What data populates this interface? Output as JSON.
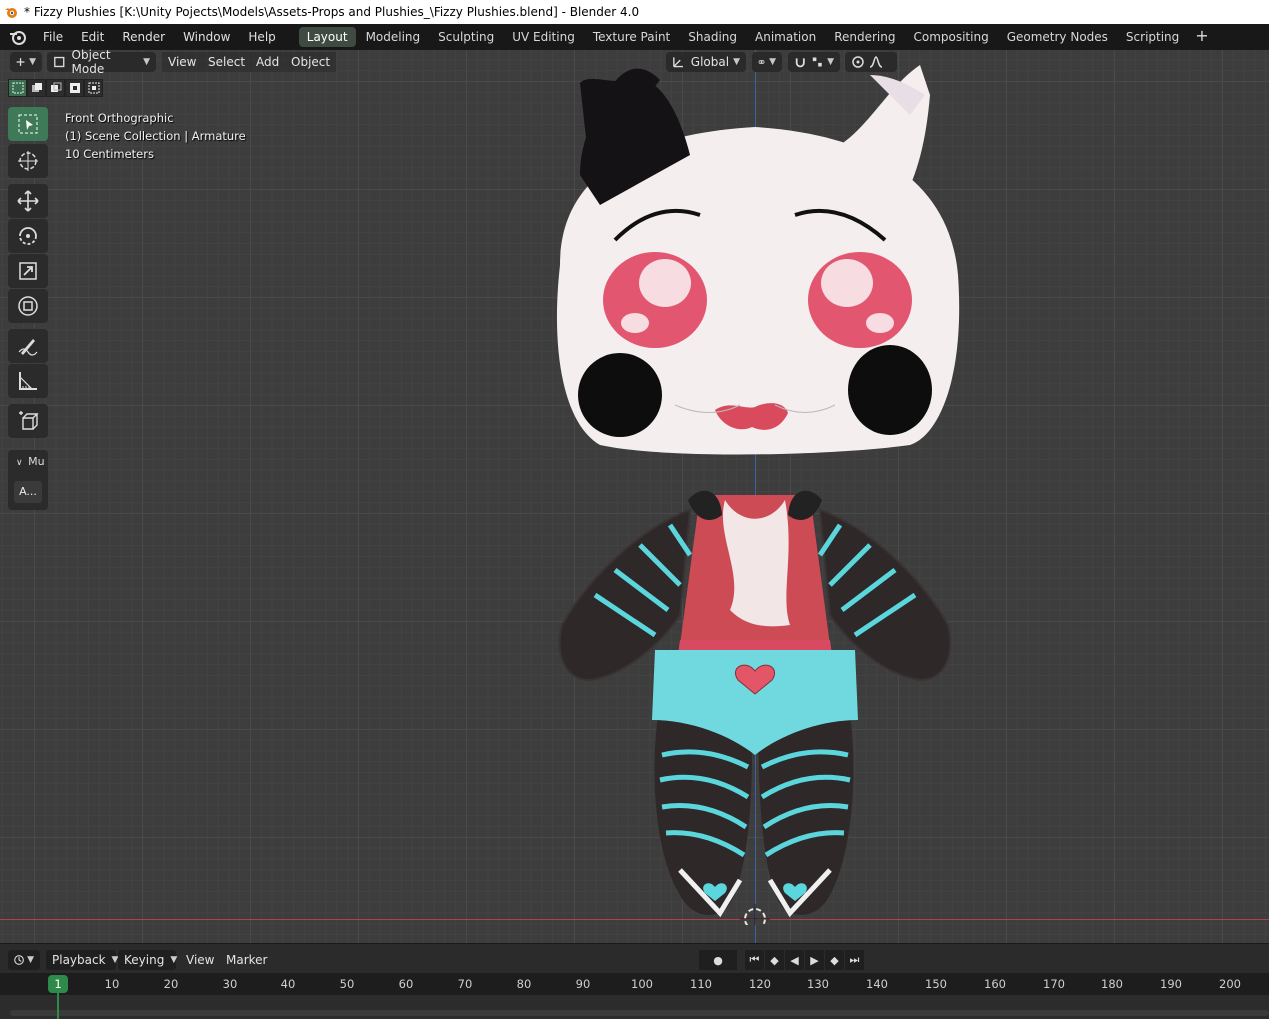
{
  "title": "* Fizzy Plushies [K:\\Unity Pojects\\Models\\Assets-Props and Plushies_\\Fizzy Plushies.blend] - Blender 4.0",
  "menu": [
    "File",
    "Edit",
    "Render",
    "Window",
    "Help"
  ],
  "workspaces": [
    "Layout",
    "Modeling",
    "Sculpting",
    "UV Editing",
    "Texture Paint",
    "Shading",
    "Animation",
    "Rendering",
    "Compositing",
    "Geometry Nodes",
    "Scripting"
  ],
  "workspace_add": "+",
  "viewport": {
    "mode": "Object Mode",
    "menus": [
      "View",
      "Select",
      "Add",
      "Object"
    ],
    "transform_orientation": "Global",
    "overlay_lines": [
      "Front Orthographic",
      "(1) Scene Collection | Armature",
      "10 Centimeters"
    ]
  },
  "sidebar_panel": {
    "label": "Mu",
    "button": "A..."
  },
  "timeline": {
    "menus": {
      "playback": "Playback",
      "keying": "Keying",
      "view": "View",
      "marker": "Marker"
    },
    "current_frame": "1",
    "ticks": [
      "10",
      "20",
      "30",
      "40",
      "50",
      "60",
      "70",
      "80",
      "90",
      "100",
      "110",
      "120",
      "130",
      "140",
      "150",
      "160",
      "170",
      "180",
      "190",
      "200"
    ]
  },
  "colors": {
    "accent": "#3e7a57",
    "active_workspace": "#3f4a43",
    "axis_x": "#b23f4c",
    "axis_z": "#3b63a0"
  }
}
